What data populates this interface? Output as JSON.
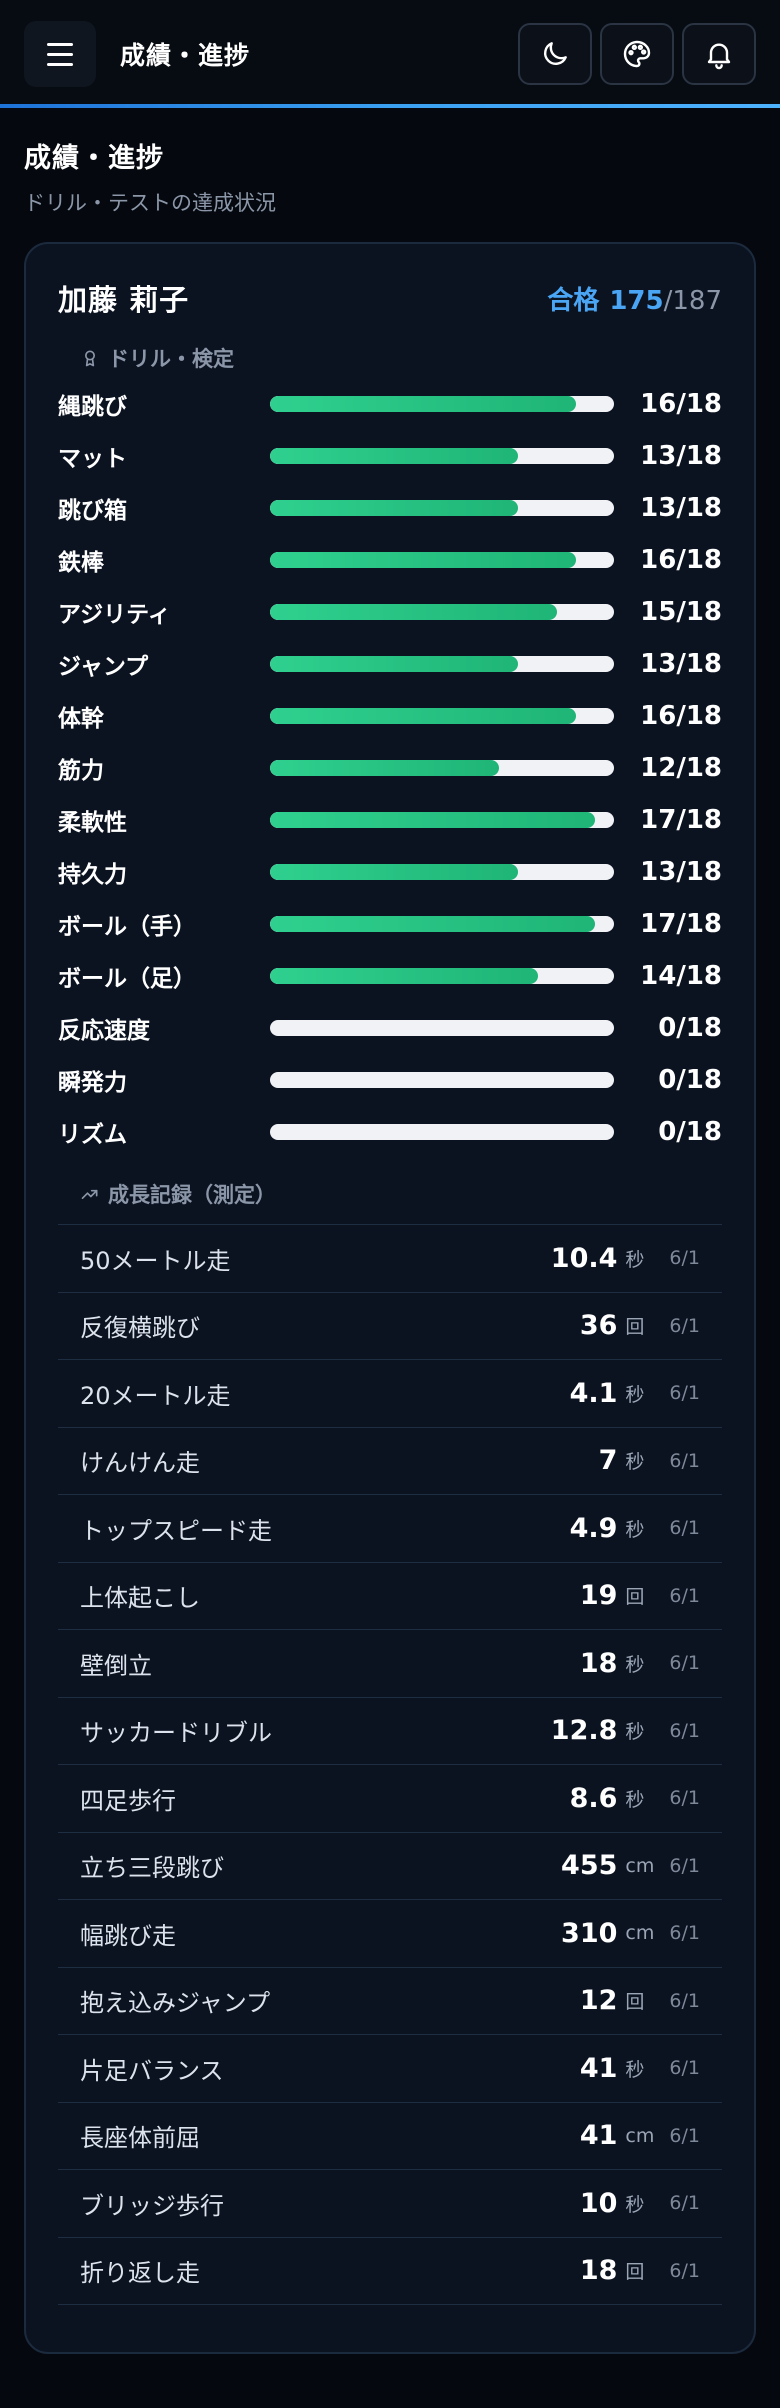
{
  "header": {
    "title": "成績・進捗"
  },
  "page": {
    "title": "成績・進捗",
    "subtitle": "ドリル・テストの達成状況"
  },
  "student": {
    "name": "加藤 莉子",
    "pass_label": "合格",
    "passed": "175",
    "total": "/187"
  },
  "drills": {
    "heading": "ドリル・検定",
    "items": [
      {
        "label": "縄跳び",
        "score": "16/18",
        "progress": 0.889
      },
      {
        "label": "マット",
        "score": "13/18",
        "progress": 0.722
      },
      {
        "label": "跳び箱",
        "score": "13/18",
        "progress": 0.722
      },
      {
        "label": "鉄棒",
        "score": "16/18",
        "progress": 0.889
      },
      {
        "label": "アジリティ",
        "score": "15/18",
        "progress": 0.833
      },
      {
        "label": "ジャンプ",
        "score": "13/18",
        "progress": 0.722
      },
      {
        "label": "体幹",
        "score": "16/18",
        "progress": 0.889
      },
      {
        "label": "筋力",
        "score": "12/18",
        "progress": 0.667
      },
      {
        "label": "柔軟性",
        "score": "17/18",
        "progress": 0.944
      },
      {
        "label": "持久力",
        "score": "13/18",
        "progress": 0.722
      },
      {
        "label": "ボール（手）",
        "score": "17/18",
        "progress": 0.944
      },
      {
        "label": "ボール（足）",
        "score": "14/18",
        "progress": 0.778
      },
      {
        "label": "反応速度",
        "score": "0/18",
        "progress": 0
      },
      {
        "label": "瞬発力",
        "score": "0/18",
        "progress": 0
      },
      {
        "label": "リズム",
        "score": "0/18",
        "progress": 0
      }
    ]
  },
  "growth": {
    "heading": "成長記録（測定）",
    "items": [
      {
        "name": "50メートル走",
        "value": "10.4",
        "unit": "秒",
        "date": "6/1"
      },
      {
        "name": "反復横跳び",
        "value": "36",
        "unit": "回",
        "date": "6/1"
      },
      {
        "name": "20メートル走",
        "value": "4.1",
        "unit": "秒",
        "date": "6/1"
      },
      {
        "name": "けんけん走",
        "value": "7",
        "unit": "秒",
        "date": "6/1"
      },
      {
        "name": "トップスピード走",
        "value": "4.9",
        "unit": "秒",
        "date": "6/1"
      },
      {
        "name": "上体起こし",
        "value": "19",
        "unit": "回",
        "date": "6/1"
      },
      {
        "name": "壁倒立",
        "value": "18",
        "unit": "秒",
        "date": "6/1"
      },
      {
        "name": "サッカードリブル",
        "value": "12.8",
        "unit": "秒",
        "date": "6/1"
      },
      {
        "name": "四足歩行",
        "value": "8.6",
        "unit": "秒",
        "date": "6/1"
      },
      {
        "name": "立ち三段跳び",
        "value": "455",
        "unit": "cm",
        "date": "6/1"
      },
      {
        "name": "幅跳び走",
        "value": "310",
        "unit": "cm",
        "date": "6/1"
      },
      {
        "name": "抱え込みジャンプ",
        "value": "12",
        "unit": "回",
        "date": "6/1"
      },
      {
        "name": "片足バランス",
        "value": "41",
        "unit": "秒",
        "date": "6/1"
      },
      {
        "name": "長座体前屈",
        "value": "41",
        "unit": "cm",
        "date": "6/1"
      },
      {
        "name": "ブリッジ歩行",
        "value": "10",
        "unit": "秒",
        "date": "6/1"
      },
      {
        "name": "折り返し走",
        "value": "18",
        "unit": "回",
        "date": "6/1"
      }
    ]
  },
  "colors": {
    "accent": "#4aa6f5",
    "bar": "#2fd08f",
    "track": "#f0f2f6",
    "background": "#05080e"
  },
  "icons": {
    "menu": "hamburger-icon",
    "theme": "moon-icon",
    "palette": "palette-icon",
    "notify": "bell-icon"
  }
}
